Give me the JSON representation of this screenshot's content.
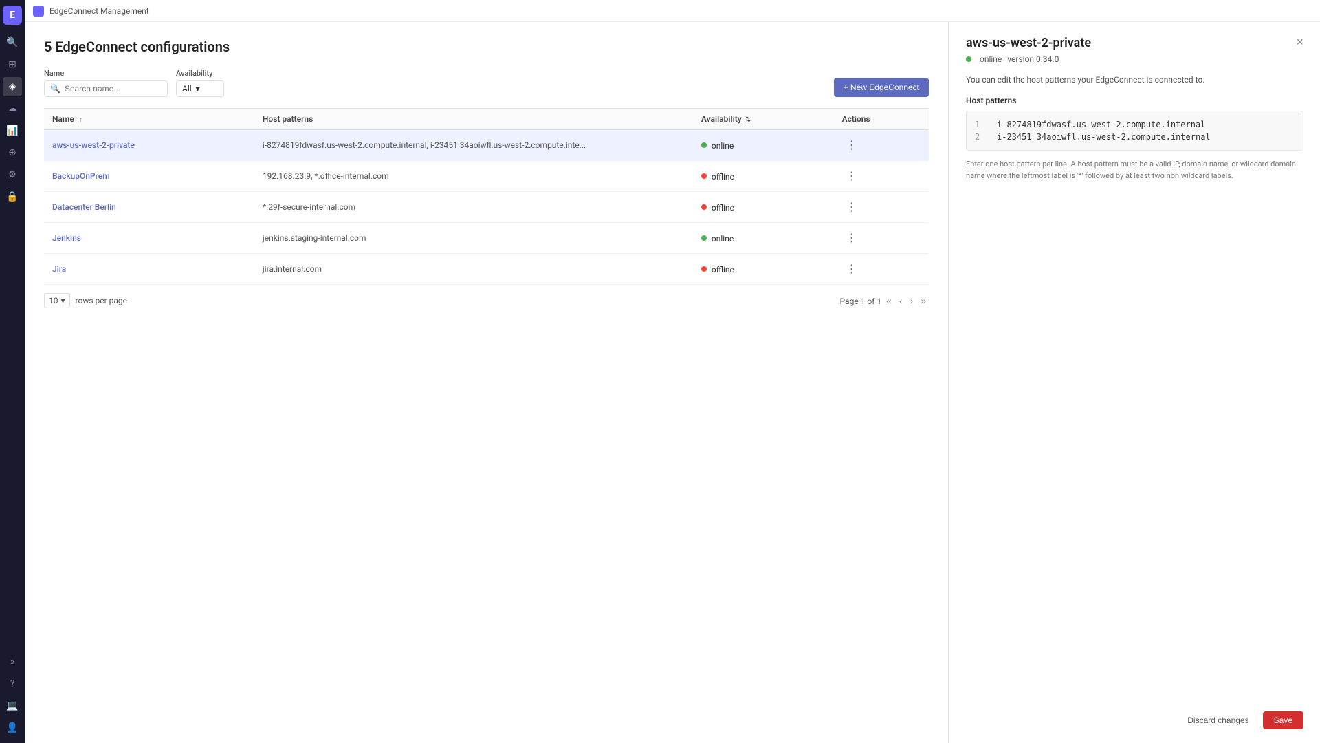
{
  "app": {
    "title": "EdgeConnect Management",
    "logo_char": "E"
  },
  "sidebar": {
    "icons": [
      {
        "name": "search-icon",
        "glyph": "🔍",
        "active": false
      },
      {
        "name": "grid-icon",
        "glyph": "⊞",
        "active": false
      },
      {
        "name": "network-icon",
        "glyph": "◈",
        "active": true
      },
      {
        "name": "cloud-icon",
        "glyph": "☁",
        "active": false
      },
      {
        "name": "shield-icon",
        "glyph": "⊕",
        "active": false
      },
      {
        "name": "settings-icon",
        "glyph": "⚙",
        "active": false
      },
      {
        "name": "lock-icon",
        "glyph": "🔒",
        "active": false
      }
    ],
    "bottom_icons": [
      {
        "name": "expand-icon",
        "glyph": "»"
      },
      {
        "name": "help-icon",
        "glyph": "?"
      },
      {
        "name": "device-icon",
        "glyph": "💻"
      },
      {
        "name": "user-icon",
        "glyph": "👤"
      }
    ]
  },
  "page": {
    "title": "5 EdgeConnect configurations",
    "filters": {
      "name_label": "Name",
      "search_placeholder": "Search name...",
      "availability_label": "Availability",
      "availability_value": "All"
    },
    "new_button_label": "+ New EdgeConnect"
  },
  "table": {
    "columns": [
      {
        "key": "name",
        "label": "Name",
        "sortable": true
      },
      {
        "key": "host_patterns",
        "label": "Host patterns"
      },
      {
        "key": "availability",
        "label": "Availability",
        "sortable": true
      },
      {
        "key": "actions",
        "label": "Actions"
      }
    ],
    "rows": [
      {
        "name": "aws-us-west-2-private",
        "host_patterns": "i-8274819fdwasf.us-west-2.compute.internal, i-23451 34aoiwfl.us-west-2.compute.inte...",
        "availability": "online",
        "selected": true
      },
      {
        "name": "BackupOnPrem",
        "host_patterns": "192.168.23.9, *.office-internal.com",
        "availability": "offline",
        "selected": false
      },
      {
        "name": "Datacenter Berlin",
        "host_patterns": "*.29f-secure-internal.com",
        "availability": "offline",
        "selected": false
      },
      {
        "name": "Jenkins",
        "host_patterns": "jenkins.staging-internal.com",
        "availability": "online",
        "selected": false
      },
      {
        "name": "Jira",
        "host_patterns": "jira.internal.com",
        "availability": "offline",
        "selected": false
      }
    ]
  },
  "pagination": {
    "per_page": "10",
    "rows_per_page_label": "rows per page",
    "page_info": "Page 1 of 1"
  },
  "detail": {
    "title": "aws-us-west-2-private",
    "status": "online",
    "version_label": "version 0.34.0",
    "description": "You can edit the host patterns your EdgeConnect is connected to.",
    "host_patterns_label": "Host patterns",
    "host_patterns": [
      "i-8274819fdwasf.us-west-2.compute.internal",
      "i-23451 34aoiwfl.us-west-2.compute.internal"
    ],
    "hint": "Enter one host pattern per line. A host pattern must be a valid IP, domain name, or wildcard domain name where the leftmost label is '*' followed by at least two non wildcard labels.",
    "discard_label": "Discard changes",
    "save_label": "Save"
  }
}
